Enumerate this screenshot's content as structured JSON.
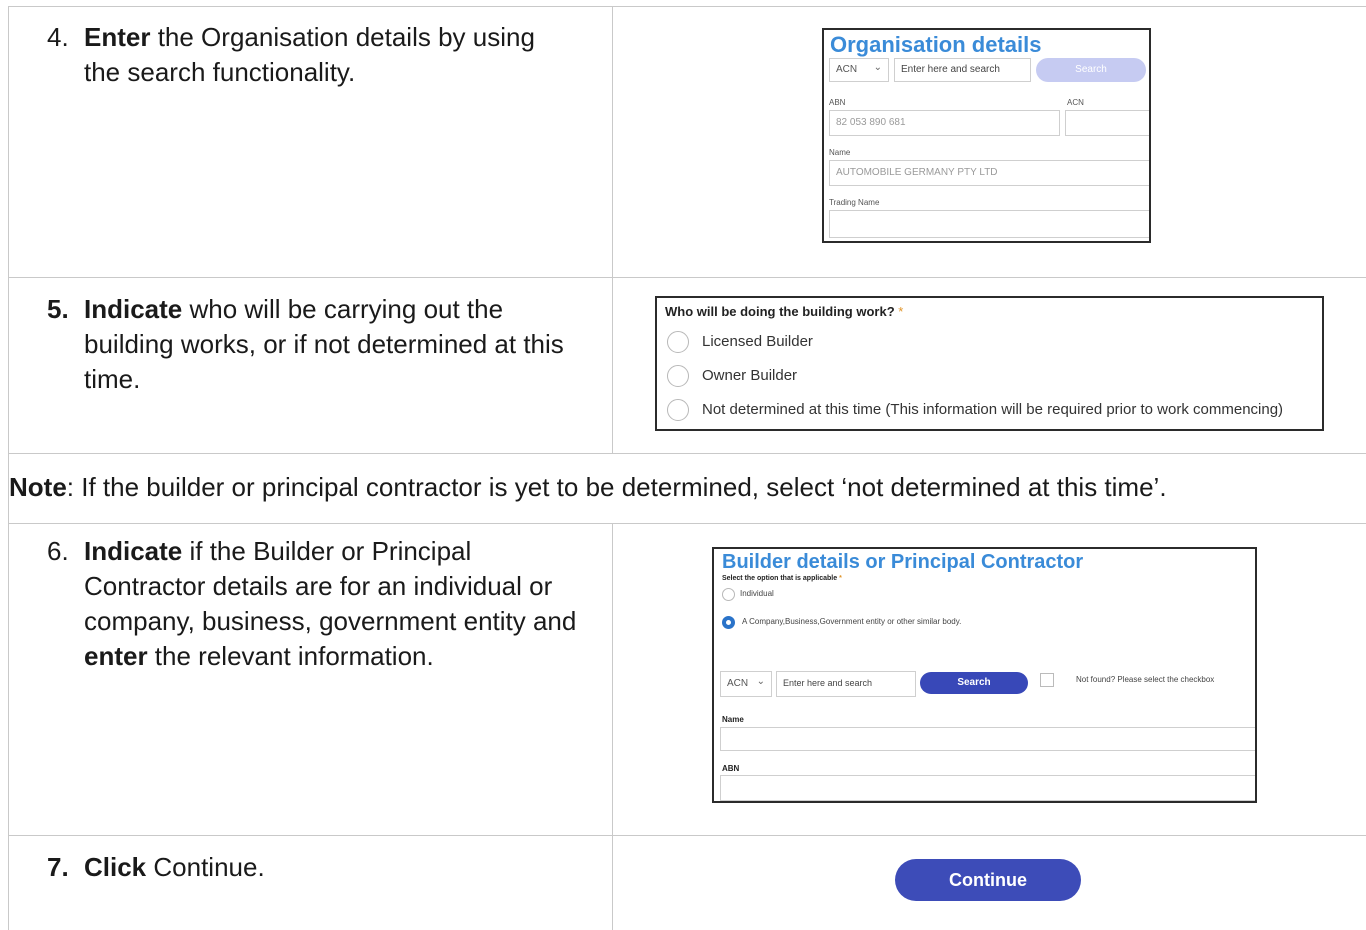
{
  "steps": [
    {
      "num": "4.",
      "keyword": "Enter",
      "rest1": " the Organisation details by using",
      "line2": "the search functionality."
    },
    {
      "num": "5.",
      "keyword": "Indicate",
      "rest1": " who will be carrying out the",
      "line2": "building works, or if not determined at this",
      "line3": "time."
    },
    {
      "num": "6.",
      "keyword": "Indicate",
      "rest1": " if the Builder or Principal",
      "line2": "Contractor details are for an individual or",
      "line3": "company, business, government entity and",
      "kw2": "enter",
      "line4rest": " the relevant information."
    },
    {
      "num": "7.",
      "keyword": "Click",
      "rest1": " Continue."
    }
  ],
  "note": {
    "label": "Note",
    "text": ":  If the builder or principal contractor is yet to be determined, select ‘not determined at this time’."
  },
  "org_panel": {
    "title": "Organisation details",
    "id_type": "ACN",
    "search_placeholder": "Enter here and search",
    "search_button": "Search",
    "abn_label": "ABN",
    "acn_label": "ACN",
    "abn_value": "82 053 890 681",
    "name_label": "Name",
    "name_value": "AUTOMOBILE GERMANY PTY LTD",
    "trading_label": "Trading Name"
  },
  "builder_question": {
    "title": "Who will be doing the building work?",
    "required": "*",
    "options": [
      "Licensed Builder",
      "Owner Builder",
      "Not determined at this time (This information will be required prior to work commencing)"
    ]
  },
  "builder_panel": {
    "title": "Builder details or Principal Contractor",
    "subtitle": "Select the option that is applicable",
    "required": "*",
    "option_individual": "Individual",
    "option_company": "A Company,Business,Government entity or other similar body.",
    "id_type": "ACN",
    "search_placeholder": "Enter here and search",
    "search_button": "Search",
    "not_found": "Not found? Please select the checkbox",
    "name_label": "Name",
    "abn_label": "ABN"
  },
  "continue_button": "Continue"
}
